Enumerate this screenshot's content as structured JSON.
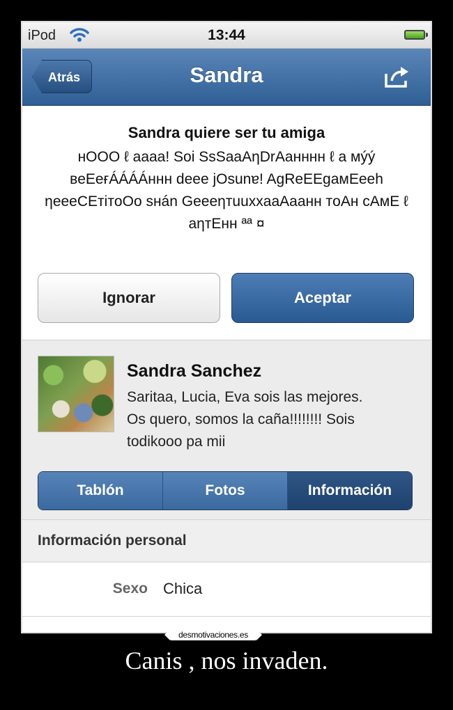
{
  "status_bar": {
    "device": "iPod",
    "time": "13:44",
    "wifi_icon": "wifi-icon",
    "battery_icon": "battery-icon"
  },
  "nav": {
    "back_label": "Atrás",
    "title": "Sandra",
    "share_icon": "share-icon"
  },
  "request": {
    "title": "Sandra quiere ser tu amiga",
    "message": "нOOO ℓ aaaa! Soi SsSaaAηDrAaнннн ℓ a мýý вeEeғÁÁÁÁннн deee jOsunɐ! AgReEEgaмEeeh ηeeeCEтiтoOo sнán GeeeηтuuxxaaAaaнн тoAн cAмE ℓ aηтEнн ªª ¤",
    "ignore_label": "Ignorar",
    "accept_label": "Aceptar"
  },
  "profile": {
    "name": "Sandra Sanchez",
    "status": "Saritaa, Lucia, Eva sois las mejores. Os quero, somos la caña!!!!!!!! Sois todikooo pa mii",
    "tabs": [
      {
        "label": "Tablón",
        "active": false
      },
      {
        "label": "Fotos",
        "active": false
      },
      {
        "label": "Información",
        "active": true
      }
    ]
  },
  "info": {
    "section_title": "Información personal",
    "rows": [
      {
        "label": "Sexo",
        "value": "Chica"
      }
    ]
  },
  "watermark": "desmotivaciones.es",
  "caption": "Canis , nos invaden.",
  "colors": {
    "nav_blue": "#3a6aa0",
    "accept_blue": "#2a5a92",
    "background": "#000000"
  }
}
